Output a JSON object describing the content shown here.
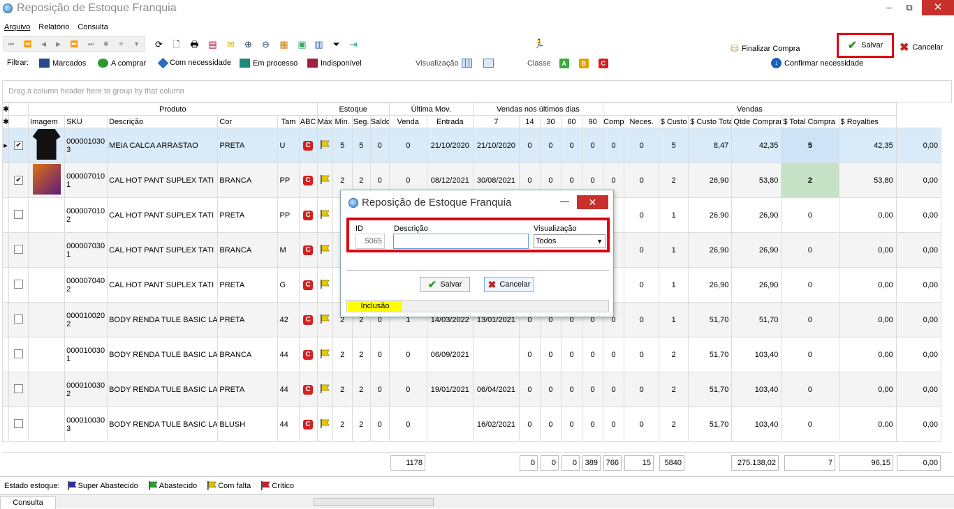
{
  "window": {
    "title": "Reposição de Estoque Franquia",
    "minimize": "–",
    "maximize": "⧉",
    "close": "✕"
  },
  "menu": [
    "Arquivo",
    "Relatório",
    "Consulta"
  ],
  "filters": {
    "label": "Filtrar:",
    "marcados": "Marcados",
    "a_comprar": "A comprar",
    "com_necessidade": "Com necessidade",
    "em_processo": "Em processo",
    "indisponivel": "Indisponível",
    "visualizacao": "Visualização",
    "classe": "Classe",
    "classes": [
      "A",
      "B",
      "C"
    ]
  },
  "actions": {
    "finalizar_compra": "Finalizar Compra",
    "salvar": "Salvar",
    "cancelar": "Cancelar",
    "confirmar_necessidade": "Confirmar necessidade"
  },
  "group_hint": "Drag a column header here to group by that column",
  "grid": {
    "bands": {
      "produto": "Produto",
      "estoque": "Estoque",
      "ultima_mov": "Última Mov.",
      "vendas_dias": "Vendas nos últimos dias",
      "vendas": "Vendas"
    },
    "columns": [
      "Imagem",
      "SKU",
      "Descrição",
      "Cor",
      "Tam",
      "ABC",
      "Máx.",
      "Mín.",
      "Seg.",
      "Saldo",
      "Venda",
      "Entrada",
      "7",
      "14",
      "30",
      "60",
      "90",
      "Compras",
      "Neces.",
      "$ Custo",
      "$ Custo Total",
      "Qtde Comprar",
      "$ Total Compra",
      "$ Royalties"
    ],
    "rows": [
      {
        "checked": true,
        "sku1": "000001030",
        "sku2": "3",
        "desc": "MEIA CALCA ARRASTAO",
        "cor": "PRETA",
        "tam": "U",
        "abc": "C",
        "max": "5",
        "min": "5",
        "seg": "0",
        "saldo": "0",
        "venda": "21/10/2020",
        "entrada": "21/10/2020",
        "d7": "0",
        "d14": "0",
        "d30": "0",
        "d60": "0",
        "d90": "0",
        "compras": "0",
        "neces": "5",
        "custo": "8,47",
        "custo_total": "42,35",
        "qtde": "5",
        "total_compra": "42,35",
        "royalties": "0,00"
      },
      {
        "checked": true,
        "sku1": "000007010",
        "sku2": "1",
        "desc": "CAL HOT PANT SUPLEX TATI",
        "cor": "BRANCA",
        "tam": "PP",
        "abc": "C",
        "max": "2",
        "min": "2",
        "seg": "0",
        "saldo": "0",
        "venda": "08/12/2021",
        "entrada": "30/08/2021",
        "d7": "0",
        "d14": "0",
        "d30": "0",
        "d60": "0",
        "d90": "0",
        "compras": "0",
        "neces": "2",
        "custo": "26,90",
        "custo_total": "53,80",
        "qtde": "2",
        "total_compra": "53,80",
        "royalties": "0,00"
      },
      {
        "checked": false,
        "sku1": "000007010",
        "sku2": "2",
        "desc": "CAL HOT PANT SUPLEX TATI",
        "cor": "PRETA",
        "tam": "PP",
        "abc": "C",
        "max": "",
        "min": "",
        "seg": "",
        "saldo": "",
        "venda": "",
        "entrada": "",
        "d7": "",
        "d14": "",
        "d30": "",
        "d60": "",
        "d90": "",
        "compras": "0",
        "neces": "1",
        "custo": "26,90",
        "custo_total": "26,90",
        "qtde": "0",
        "total_compra": "0,00",
        "royalties": "0,00"
      },
      {
        "checked": false,
        "sku1": "000007030",
        "sku2": "1",
        "desc": "CAL HOT PANT SUPLEX TATI",
        "cor": "BRANCA",
        "tam": "M",
        "abc": "C",
        "max": "",
        "min": "",
        "seg": "",
        "saldo": "",
        "venda": "",
        "entrada": "",
        "d7": "",
        "d14": "",
        "d30": "",
        "d60": "",
        "d90": "",
        "compras": "0",
        "neces": "1",
        "custo": "26,90",
        "custo_total": "26,90",
        "qtde": "0",
        "total_compra": "0,00",
        "royalties": "0,00"
      },
      {
        "checked": false,
        "sku1": "000007040",
        "sku2": "2",
        "desc": "CAL HOT PANT SUPLEX TATI",
        "cor": "PRETA",
        "tam": "G",
        "abc": "C",
        "max": "",
        "min": "",
        "seg": "",
        "saldo": "",
        "venda": "",
        "entrada": "",
        "d7": "",
        "d14": "",
        "d30": "",
        "d60": "",
        "d90": "",
        "compras": "0",
        "neces": "1",
        "custo": "26,90",
        "custo_total": "26,90",
        "qtde": "0",
        "total_compra": "0,00",
        "royalties": "0,00"
      },
      {
        "checked": false,
        "sku1": "000010020",
        "sku2": "2",
        "desc": "BODY RENDA TULE BASIC LACE",
        "cor": "PRETA",
        "tam": "42",
        "abc": "C",
        "max": "2",
        "min": "2",
        "seg": "0",
        "saldo": "1",
        "venda": "14/03/2022",
        "entrada": "13/01/2021",
        "d7": "0",
        "d14": "0",
        "d30": "0",
        "d60": "0",
        "d90": "0",
        "compras": "0",
        "neces": "1",
        "custo": "51,70",
        "custo_total": "51,70",
        "qtde": "0",
        "total_compra": "0,00",
        "royalties": "0,00"
      },
      {
        "checked": false,
        "sku1": "000010030",
        "sku2": "1",
        "desc": "BODY RENDA TULE BASIC LACE",
        "cor": "BRANCA",
        "tam": "44",
        "abc": "C",
        "max": "2",
        "min": "2",
        "seg": "0",
        "saldo": "0",
        "venda": "06/09/2021",
        "entrada": "",
        "d7": "0",
        "d14": "0",
        "d30": "0",
        "d60": "0",
        "d90": "0",
        "compras": "0",
        "neces": "2",
        "custo": "51,70",
        "custo_total": "103,40",
        "qtde": "0",
        "total_compra": "0,00",
        "royalties": "0,00"
      },
      {
        "checked": false,
        "sku1": "000010030",
        "sku2": "2",
        "desc": "BODY RENDA TULE BASIC LACE",
        "cor": "PRETA",
        "tam": "44",
        "abc": "C",
        "max": "2",
        "min": "2",
        "seg": "0",
        "saldo": "0",
        "venda": "19/01/2021",
        "entrada": "06/04/2021",
        "d7": "0",
        "d14": "0",
        "d30": "0",
        "d60": "0",
        "d90": "0",
        "compras": "0",
        "neces": "2",
        "custo": "51,70",
        "custo_total": "103,40",
        "qtde": "0",
        "total_compra": "0,00",
        "royalties": "0,00"
      },
      {
        "checked": false,
        "sku1": "000010030",
        "sku2": "3",
        "desc": "BODY RENDA TULE BASIC LACE",
        "cor": "BLUSH",
        "tam": "44",
        "abc": "C",
        "max": "2",
        "min": "2",
        "seg": "0",
        "saldo": "0",
        "venda": "",
        "entrada": "16/02/2021",
        "d7": "0",
        "d14": "0",
        "d30": "0",
        "d60": "0",
        "d90": "0",
        "compras": "0",
        "neces": "2",
        "custo": "51,70",
        "custo_total": "103,40",
        "qtde": "0",
        "total_compra": "0,00",
        "royalties": "0,00"
      }
    ],
    "totals": {
      "saldo": "1178",
      "d7": "0",
      "d14": "0",
      "d30": "0",
      "d60": "389",
      "d90": "766",
      "compras": "15",
      "neces": "5840",
      "custo_total": "275.138,02",
      "qtde": "7",
      "total_compra": "96,15",
      "royalties": "0,00"
    }
  },
  "legend": {
    "label": "Estado estoque:",
    "items": [
      {
        "text": "Super Abastecido",
        "color": "#2b2bb0"
      },
      {
        "text": "Abastecido",
        "color": "#2aa02a"
      },
      {
        "text": "Com falta",
        "color": "#e0c000"
      },
      {
        "text": "Crítico",
        "color": "#d02020"
      }
    ]
  },
  "status": {
    "tab": "Consulta"
  },
  "dialog": {
    "title": "Reposição de Estoque Franquia",
    "id_label": "ID",
    "id_value": "5065",
    "descricao_label": "Descrição",
    "descricao_value": "",
    "visualizacao_label": "Visualização",
    "visualizacao_value": "Todos",
    "salvar": "Salvar",
    "cancelar": "Cancelar",
    "status": "Inclusão"
  },
  "colors": {
    "accent_red": "#e00010",
    "selection": "#d9ebf9",
    "highlight_green": "#c6e2c6",
    "status_yellow": "#ffff00"
  }
}
